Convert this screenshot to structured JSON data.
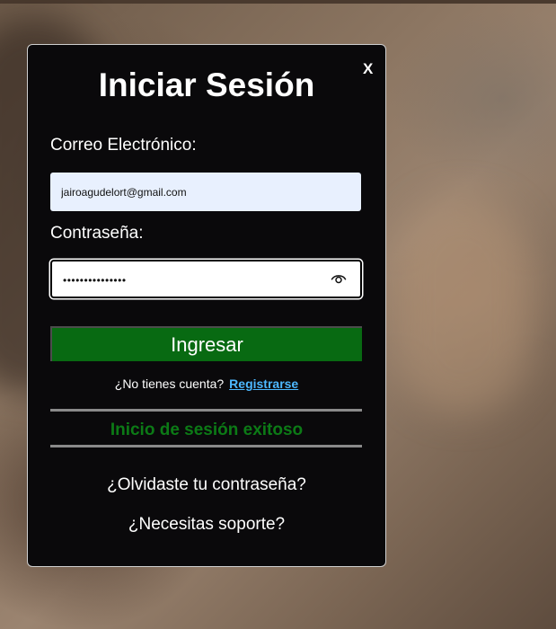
{
  "modal": {
    "close_label": "X",
    "title": "Iniciar Sesión",
    "email": {
      "label": "Correo Electrónico:",
      "value": "jairoagudelort@gmail.com"
    },
    "password": {
      "label": "Contraseña:",
      "value": "•••••••••••••••",
      "icon": "eye-icon"
    },
    "submit_label": "Ingresar",
    "register": {
      "prompt": "¿No tienes cuenta?",
      "link_label": "Registrarse"
    },
    "status_message": "Inicio de sesión exitoso",
    "forgot_password": "¿Olvidaste tu contraseña?",
    "support": "¿Necesitas soporte?"
  },
  "colors": {
    "modal_bg": "#0a090b",
    "submit_bg": "#086a12",
    "success_text": "#0c7a16",
    "link": "#4db8ff",
    "email_field_bg": "#e8f0fe"
  }
}
